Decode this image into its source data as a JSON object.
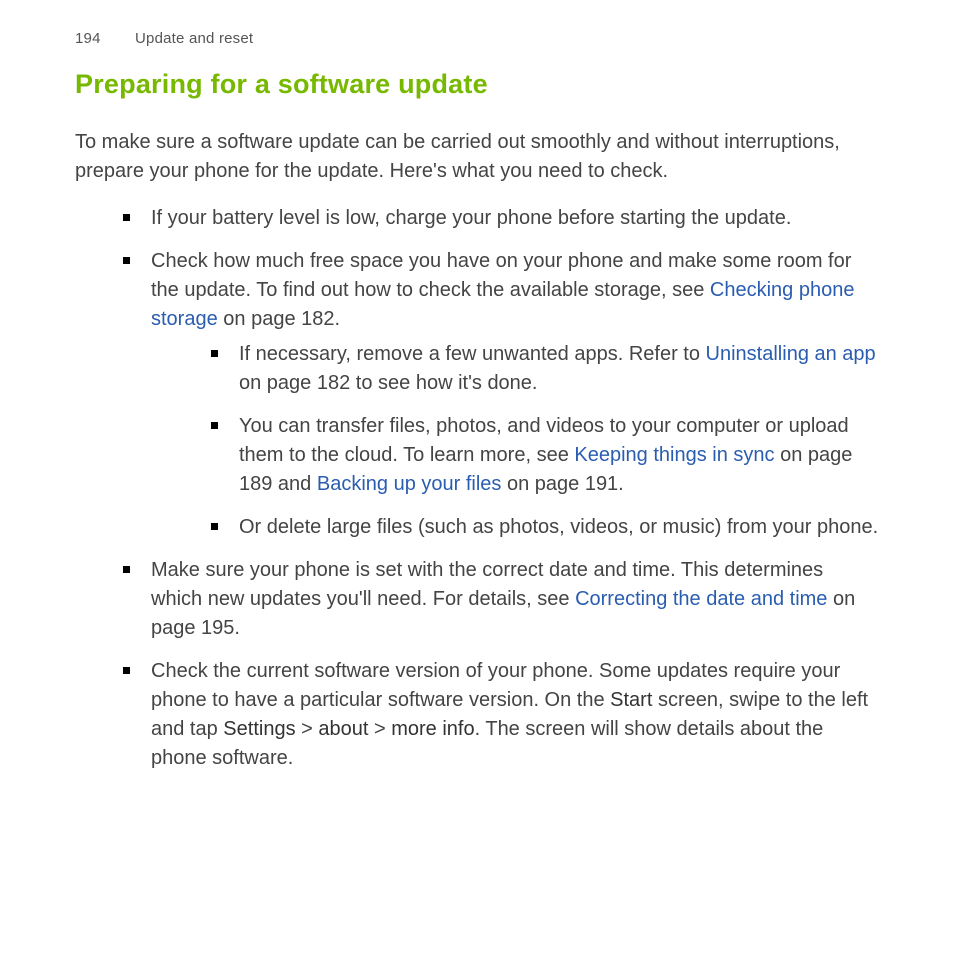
{
  "header": {
    "page_number": "194",
    "section": "Update and reset"
  },
  "title": "Preparing for a software update",
  "intro": "To make sure a software update can be carried out smoothly and without interruptions, prepare your phone for the update. Here's what you need to check.",
  "bullets": {
    "b1": "If your battery level is low, charge your phone before starting the update.",
    "b2_pre": "Check how much free space you have on your phone and make some room for the update. To find out how to check the available storage, see ",
    "b2_link": "Checking phone storage",
    "b2_post": " on page 182.",
    "b2a_pre": "If necessary, remove a few unwanted apps. Refer to ",
    "b2a_link": "Uninstalling an app",
    "b2a_post": " on page 182 to see how it's done.",
    "b2b_pre": "You can transfer files, photos, and videos to your computer or upload them to the cloud. To learn more, see ",
    "b2b_link1": "Keeping things in sync",
    "b2b_mid": " on page 189 and ",
    "b2b_link2": "Backing up your files",
    "b2b_post": " on page 191.",
    "b2c": "Or delete large files (such as photos, videos, or music) from your phone.",
    "b3_pre": "Make sure your phone is set with the correct date and time. This determines which new updates you'll need. For details, see ",
    "b3_link": "Correcting the date and time",
    "b3_post": " on page 195.",
    "b4_pre": "Check the current software version of your phone. Some updates require your phone to have a particular software version. On the ",
    "b4_bold1": "Start",
    "b4_mid1": " screen, swipe to the left and tap ",
    "b4_bold2": "Settings",
    "b4_sep1": " > ",
    "b4_bold3": "about",
    "b4_sep2": " > ",
    "b4_bold4": "more info",
    "b4_post": ". The screen will show details about the phone software."
  }
}
